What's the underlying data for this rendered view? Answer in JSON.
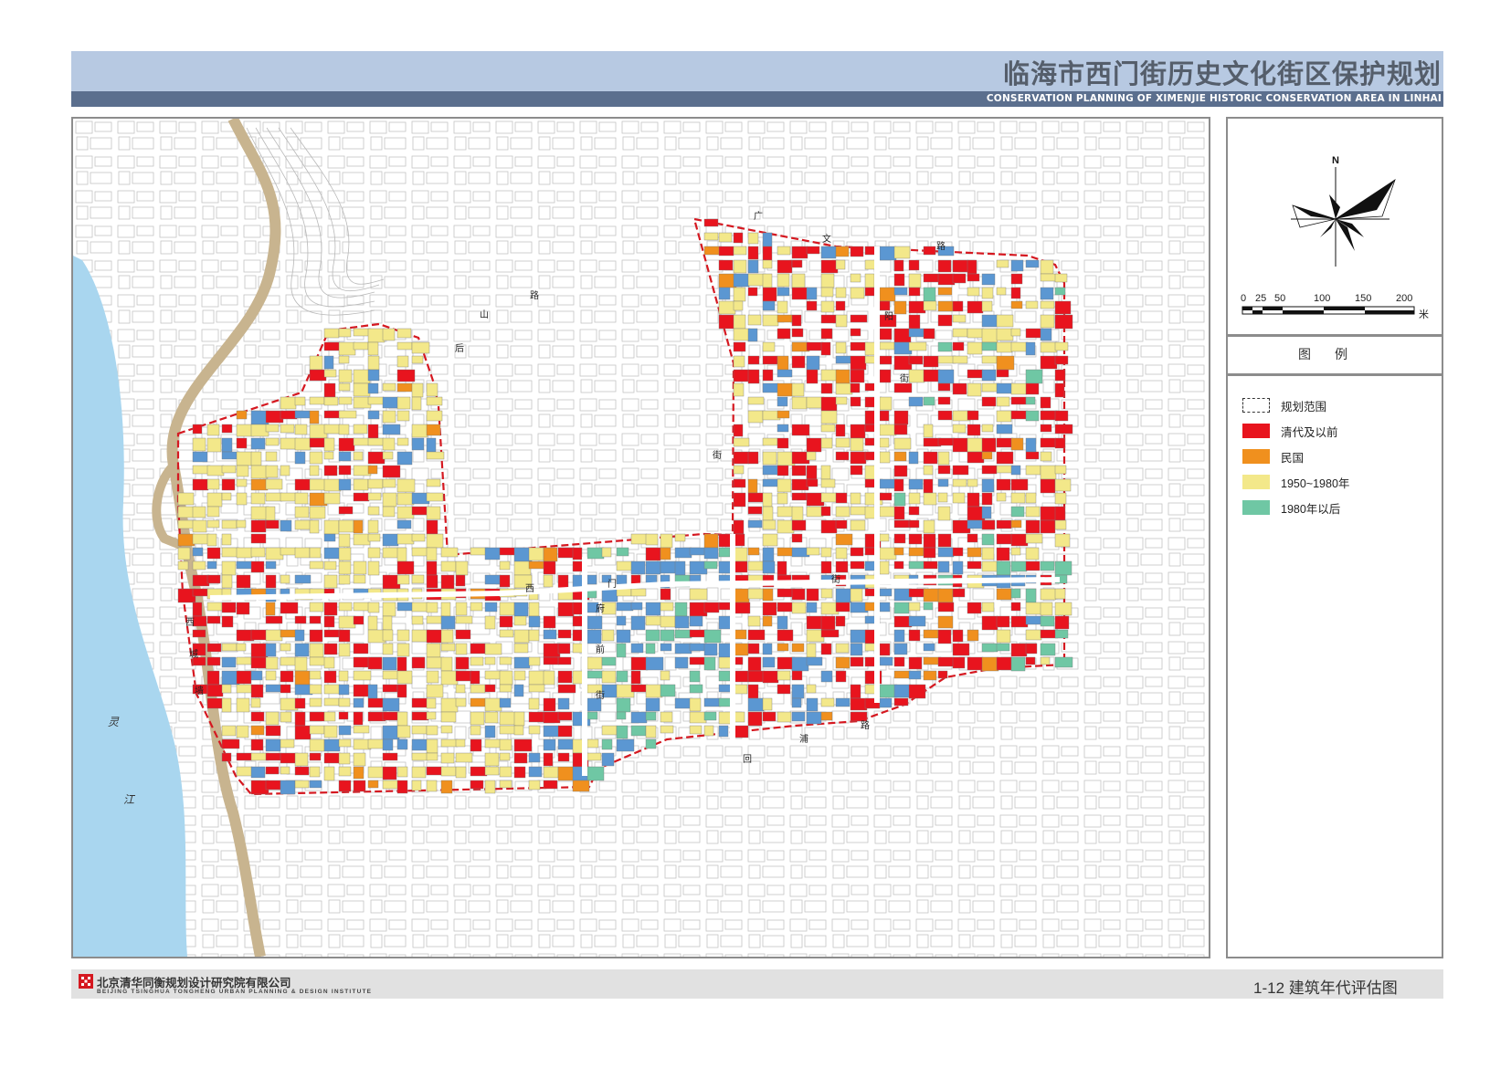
{
  "header": {
    "title": "临海市西门街历史文化街区保护规划",
    "subtitle": "CONSERVATION PLANNING OF XIMENJIE HISTORIC CONSERVATION AREA IN LINHAI"
  },
  "map": {
    "north_label": "N",
    "scale_bar": {
      "ticks": [
        "0",
        "25",
        "50",
        "100",
        "150",
        "200"
      ],
      "unit": "米"
    },
    "road_labels": {
      "guangwen_1": "广",
      "guangwen_2": "文",
      "guangwen_3": "路",
      "houshan_1": "路",
      "houshan_2": "山",
      "houshan_3": "后",
      "ziyang_1": "紫",
      "ziyang_2": "阳",
      "ziyang_3": "街",
      "ximen_1": "西",
      "ximen_2": "门",
      "ximen_3": "街",
      "fuqian_1": "府",
      "fuqian_2": "前",
      "fuqian_3": "街",
      "xicheng_1": "西",
      "xicheng_2": "城",
      "xicheng_3": "墙",
      "huihai_1": "回",
      "huihai_2": "浦",
      "huihai_3": "路",
      "jie": "街"
    },
    "river_label_1": "灵",
    "river_label_2": "江"
  },
  "legend": {
    "title": "图例",
    "items": [
      {
        "label": "规划范围",
        "color": "#ffffff",
        "style": "dashed"
      },
      {
        "label": "清代及以前",
        "color": "#e8141e",
        "style": "fill"
      },
      {
        "label": "民国",
        "color": "#f0901e",
        "style": "fill"
      },
      {
        "label": "1950~1980年",
        "color": "#f3e88a",
        "style": "fill"
      },
      {
        "label": "1980年以后",
        "color": "#6fc7a4",
        "style": "fill"
      }
    ]
  },
  "extra_building_color": "#5b97d2",
  "footer": {
    "company_cn": "北京清华同衡规划设计研究院有限公司",
    "company_en": "BEIJING TSINGHUA TONGHENG URBAN PLANNING & DESIGN INSTITUTE",
    "figure_title": "1-12 建筑年代评估图"
  }
}
